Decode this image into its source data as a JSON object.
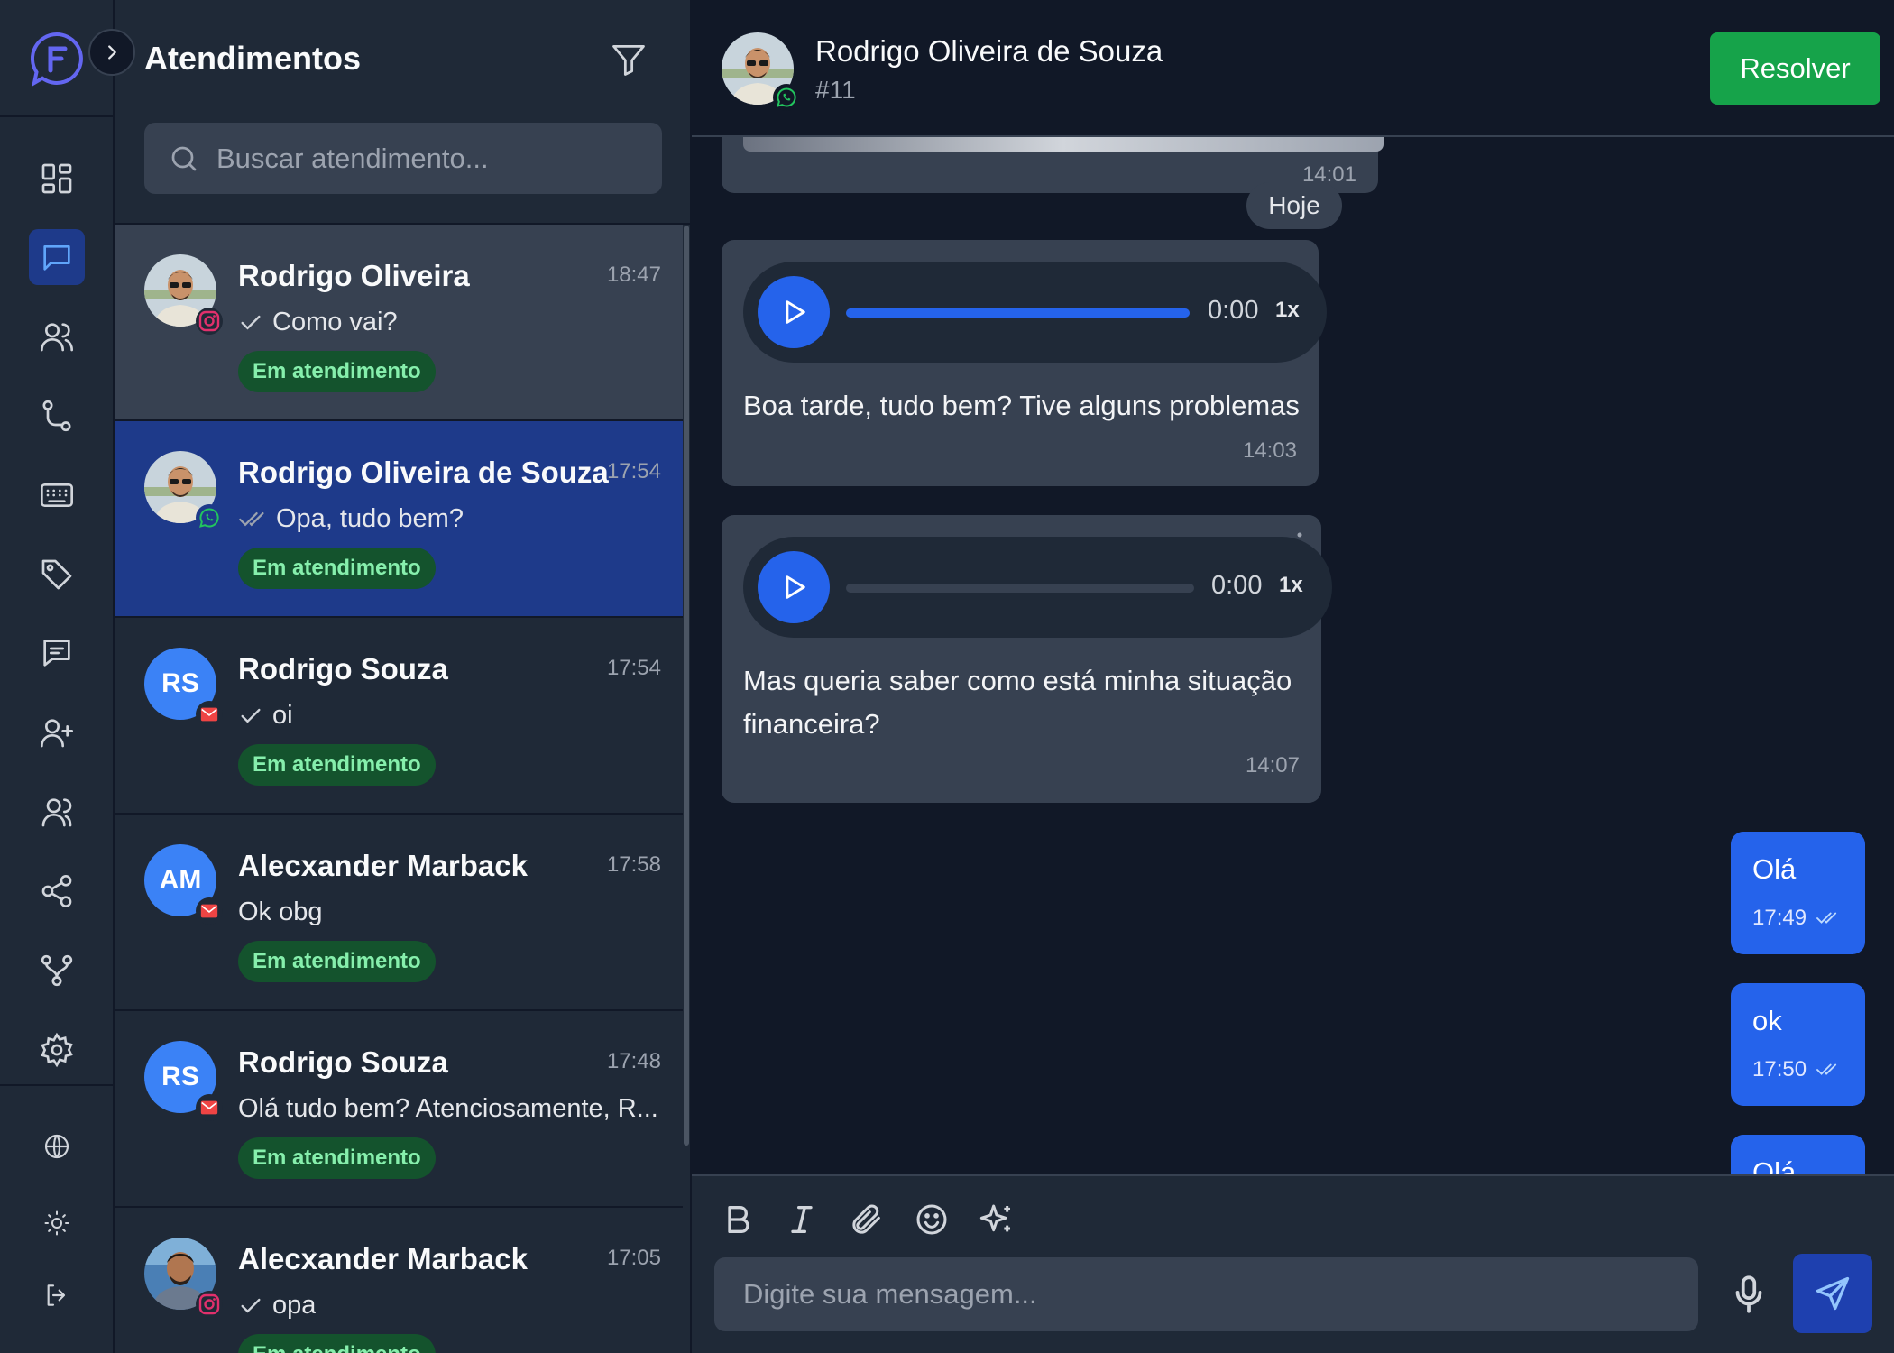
{
  "colors": {
    "accent": "#2563eb",
    "status_bg": "#14532d",
    "status_fg": "#86efac",
    "resolve": "#16a34a"
  },
  "rail": {
    "items": [
      "dashboard-icon",
      "chat-icon",
      "contacts-icon",
      "flow-icon",
      "keyboard-icon",
      "tag-icon",
      "message-icon",
      "add-user-icon",
      "team-icon",
      "share-icon",
      "integration-icon",
      "settings-icon",
      "globe-icon",
      "sun-icon",
      "logout-icon"
    ],
    "active": "chat-icon"
  },
  "list": {
    "title": "Atendimentos",
    "search_placeholder": "Buscar atendimento...",
    "conversations": [
      {
        "name": "Rodrigo Oliveira",
        "time": "18:47",
        "preview": "Como vai?",
        "check": "single",
        "status": "Em atendimento",
        "channel": "instagram",
        "avatar": "photo"
      },
      {
        "name": "Rodrigo Oliveira de Souza",
        "time": "17:54",
        "preview": "Opa, tudo bem?",
        "check": "double",
        "status": "Em atendimento",
        "channel": "whatsapp",
        "avatar": "photo"
      },
      {
        "name": "Rodrigo Souza",
        "time": "17:54",
        "preview": "oi",
        "check": "single",
        "status": "Em atendimento",
        "channel": "email",
        "initials": "RS"
      },
      {
        "name": "Alecxander Marback",
        "time": "17:58",
        "preview": "Ok obg",
        "check": "none",
        "status": "Em atendimento",
        "channel": "email",
        "initials": "AM"
      },
      {
        "name": "Rodrigo Souza",
        "time": "17:48",
        "preview": "Olá tudo bem? Atenciosamente, R...",
        "check": "none",
        "status": "Em atendimento",
        "channel": "email",
        "initials": "RS"
      },
      {
        "name": "Alecxander Marback",
        "time": "17:05",
        "preview": "opa",
        "check": "single",
        "status": "Em atendimento",
        "channel": "instagram",
        "avatar": "photo"
      }
    ]
  },
  "chat": {
    "name": "Rodrigo Oliveira de Souza",
    "ticket": "#11",
    "resolve_label": "Resolver",
    "day_separator": "Hoje",
    "prev_time": "14:01",
    "incoming": [
      {
        "audio_duration": "0:00",
        "audio_speed": "1x",
        "audio_progress": 1.0,
        "text": "Boa tarde, tudo bem? Tive alguns problemas",
        "time": "14:03"
      },
      {
        "audio_duration": "0:00",
        "audio_speed": "1x",
        "audio_progress": 0.0,
        "text_line1": "Mas queria saber como está minha situação",
        "text_line2": "financeira?",
        "time": "14:07"
      }
    ],
    "outgoing": [
      {
        "text": "Olá",
        "time": "17:49"
      },
      {
        "text": "ok",
        "time": "17:50"
      },
      {
        "text": "Olá",
        "time": ""
      }
    ]
  },
  "composer": {
    "placeholder": "Digite sua mensagem...",
    "tools": [
      "bold-icon",
      "italic-icon",
      "attach-icon",
      "emoji-icon",
      "ai-sparkle-icon"
    ]
  }
}
